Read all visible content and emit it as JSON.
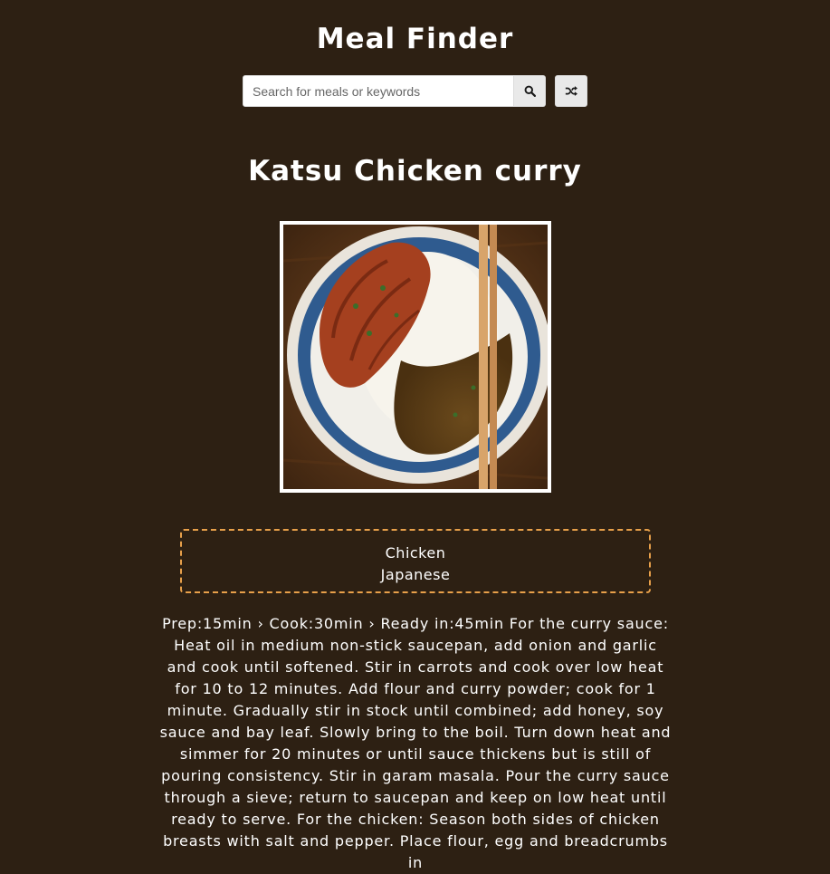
{
  "header": {
    "title": "Meal Finder"
  },
  "search": {
    "placeholder": "Search for meals or keywords",
    "value": "",
    "search_icon": "search-icon",
    "random_icon": "shuffle-icon"
  },
  "meal": {
    "title": "Katsu Chicken curry",
    "image_alt": "Katsu Chicken curry",
    "category": "Chicken",
    "area": "Japanese",
    "instructions": "Prep:15min › Cook:30min › Ready in:45min For the curry sauce: Heat oil in medium non-stick saucepan, add onion and garlic and cook until softened. Stir in carrots and cook over low heat for 10 to 12 minutes. Add flour and curry powder; cook for 1 minute. Gradually stir in stock until combined; add honey, soy sauce and bay leaf. Slowly bring to the boil. Turn down heat and simmer for 20 minutes or until sauce thickens but is still of pouring consistency. Stir in garam masala. Pour the curry sauce through a sieve; return to saucepan and keep on low heat until ready to serve. For the chicken: Season both sides of chicken breasts with salt and pepper. Place flour, egg and breadcrumbs in"
  },
  "colors": {
    "background": "#2d2013",
    "info_border": "#e8a04a",
    "text": "#ffffff"
  }
}
